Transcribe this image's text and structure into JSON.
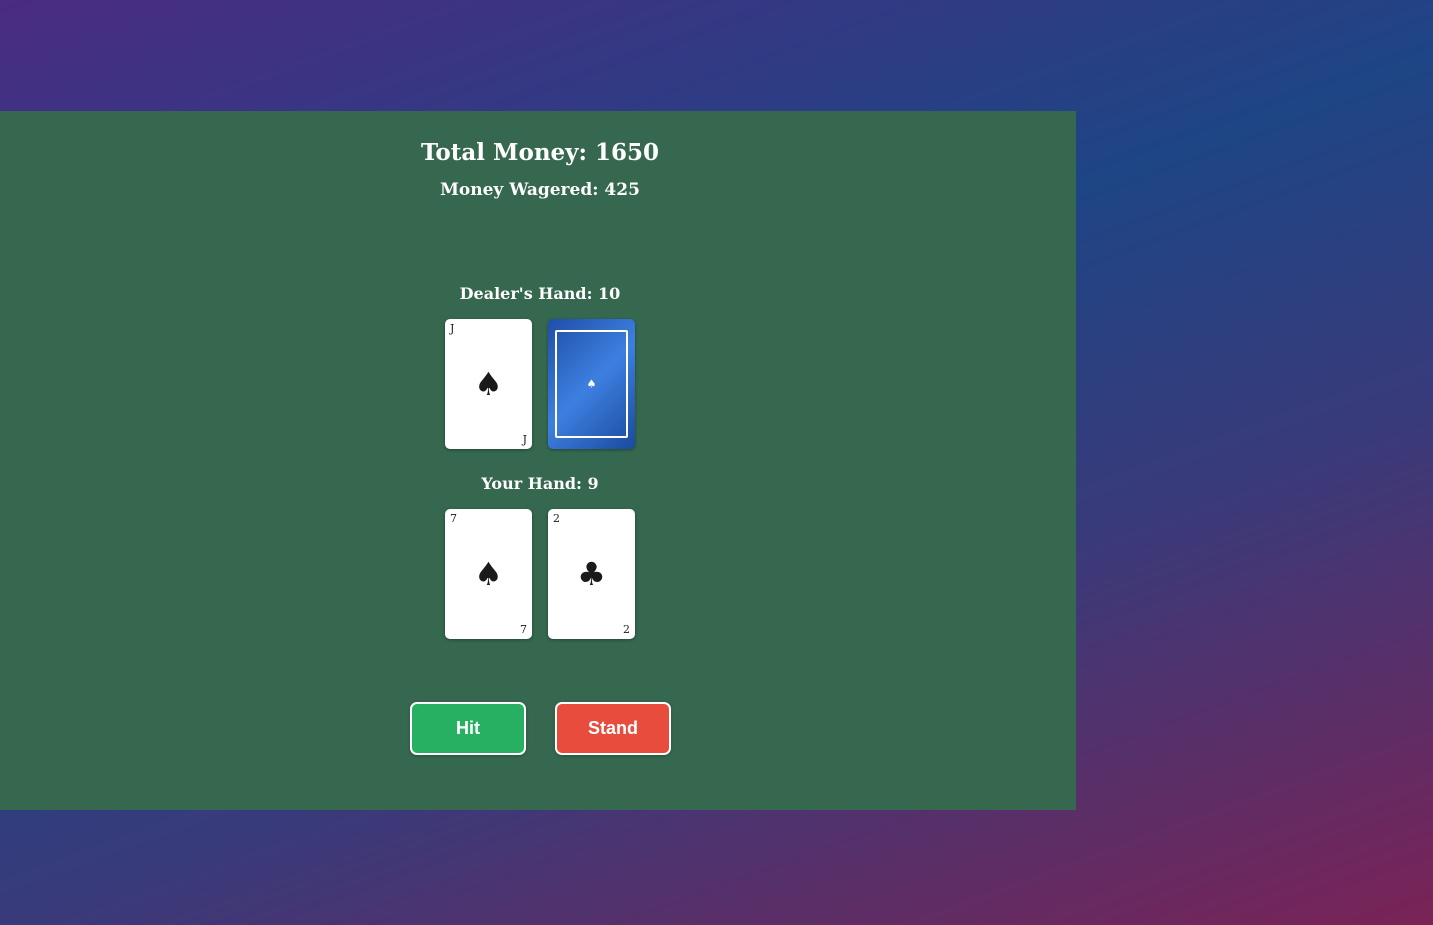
{
  "status": {
    "total_money": "Total Money: 1650",
    "money_wagered": "Money Wagered: 425"
  },
  "dealer": {
    "label": "Dealer's Hand: 10",
    "cards": [
      {
        "rank": "J",
        "suit": "♠",
        "suit_name": "spades",
        "face_up": true
      },
      {
        "face_up": false,
        "back_symbol": "♠",
        "back_color": "#2a63c9"
      }
    ]
  },
  "player": {
    "label": "Your Hand: 9",
    "cards": [
      {
        "rank": "7",
        "suit": "♠",
        "suit_name": "spades",
        "face_up": true
      },
      {
        "rank": "2",
        "suit": "♣",
        "suit_name": "clubs",
        "face_up": true
      }
    ]
  },
  "actions": {
    "hit_label": "Hit",
    "stand_label": "Stand"
  },
  "colors": {
    "table": "#36684f",
    "hit_button": "#28b062",
    "stand_button": "#e84c3c"
  }
}
